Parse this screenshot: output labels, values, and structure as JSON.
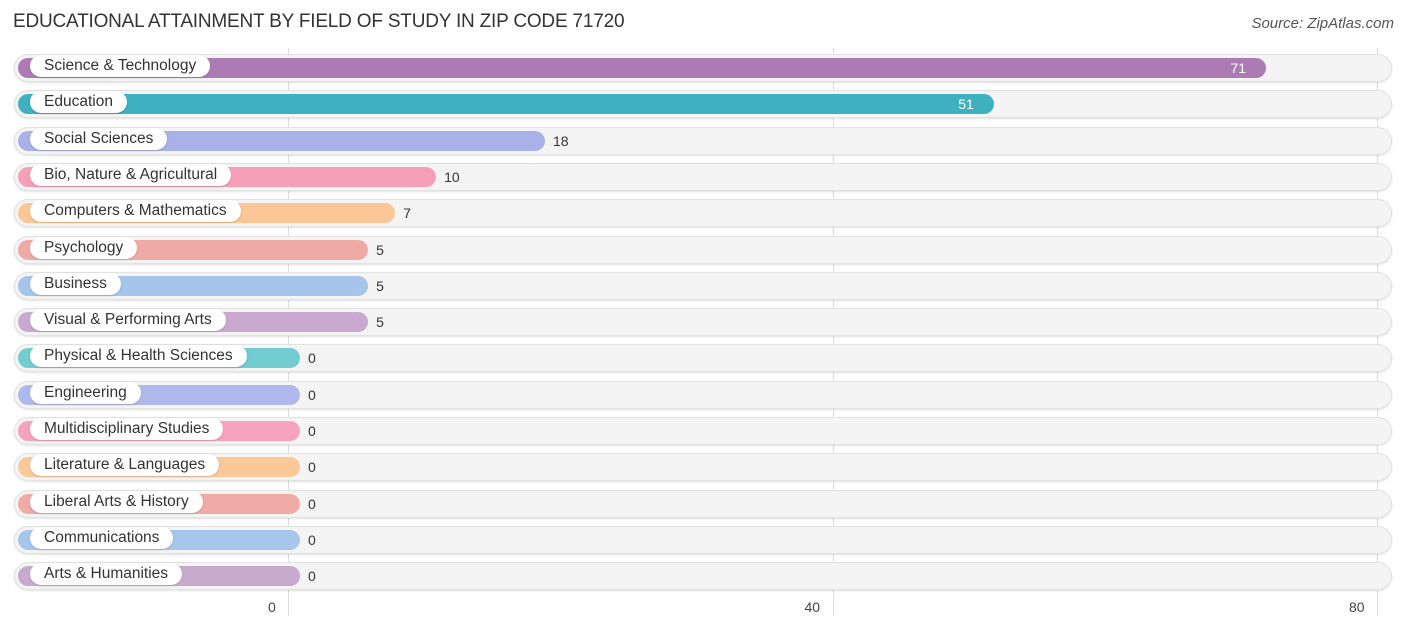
{
  "header": {
    "title": "EDUCATIONAL ATTAINMENT BY FIELD OF STUDY IN ZIP CODE 71720",
    "source": "Source: ZipAtlas.com"
  },
  "chart_data": {
    "type": "bar",
    "orientation": "horizontal",
    "title": "EDUCATIONAL ATTAINMENT BY FIELD OF STUDY IN ZIP CODE 71720",
    "xlabel": "",
    "ylabel": "",
    "xlim": [
      0,
      80
    ],
    "xticks": [
      "0",
      "40",
      "80"
    ],
    "grid": true,
    "categories": [
      "Science & Technology",
      "Education",
      "Social Sciences",
      "Bio, Nature & Agricultural",
      "Computers & Mathematics",
      "Psychology",
      "Business",
      "Visual & Performing Arts",
      "Physical & Health Sciences",
      "Engineering",
      "Multidisciplinary Studies",
      "Literature & Languages",
      "Liberal Arts & History",
      "Communications",
      "Arts & Humanities"
    ],
    "values": [
      71,
      51,
      18,
      10,
      7,
      5,
      5,
      5,
      0,
      0,
      0,
      0,
      0,
      0,
      0
    ],
    "colors": [
      "#ad7bb3",
      "#3fb0c0",
      "#a9b2e8",
      "#f59fb8",
      "#fbc796",
      "#f0aaa6",
      "#a5c5ea",
      "#c9a9d0",
      "#72ccd0",
      "#b0b9ec",
      "#f7a3bf",
      "#fbc898",
      "#f0aba6",
      "#a7c6ec",
      "#c9aacf"
    ]
  }
}
